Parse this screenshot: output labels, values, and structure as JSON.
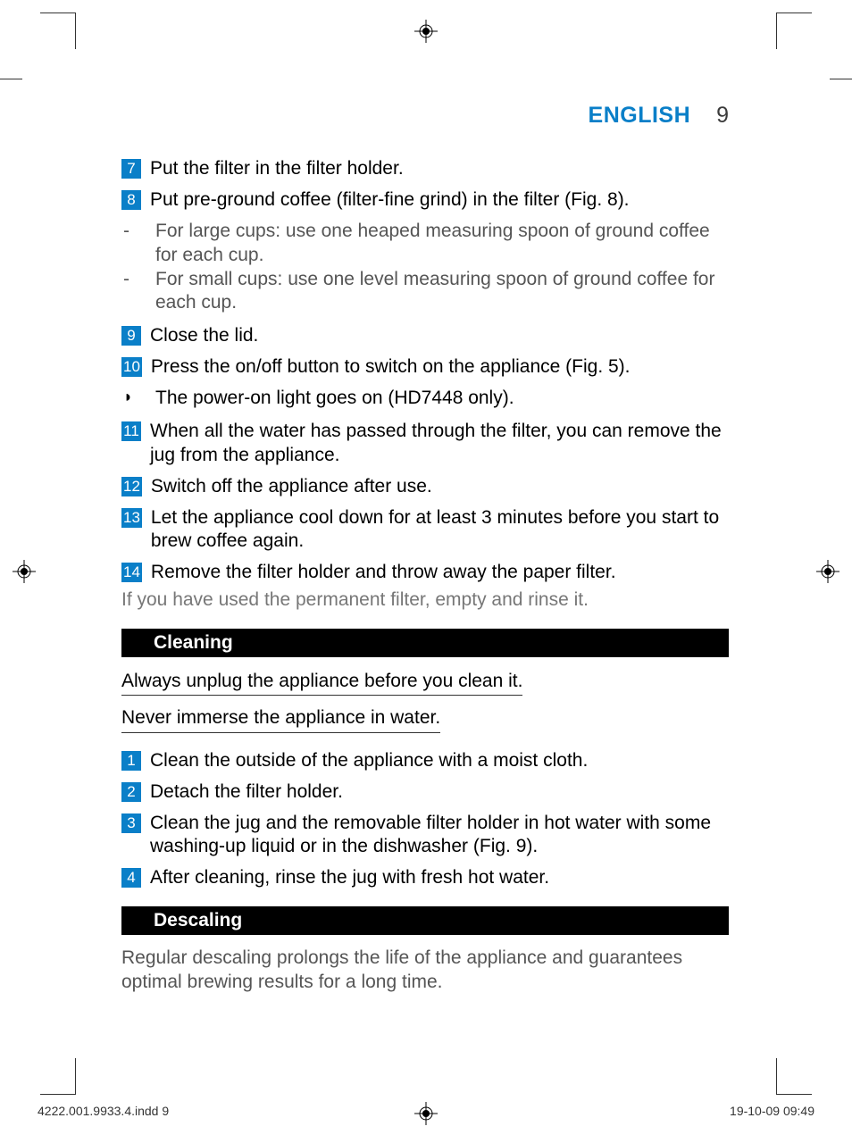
{
  "header": {
    "language": "ENGLISH",
    "page_number": "9"
  },
  "steps_a": [
    {
      "num": "7",
      "text": "Put the filter in the filter holder."
    },
    {
      "num": "8",
      "text": "Put pre-ground coffee (filter-fine grind) in the filter (Fig. 8)."
    }
  ],
  "sub8": [
    "For large cups: use one heaped measuring spoon of ground coffee for each cup.",
    "For small cups: use one level measuring spoon of ground coffee for each cup."
  ],
  "steps_b": [
    {
      "num": "9",
      "text": "Close the lid."
    },
    {
      "num": "10",
      "text": "Press the on/off button to switch on the appliance (Fig. 5)."
    }
  ],
  "arrow_note": "The power-on light goes on (HD7448 only).",
  "steps_c": [
    {
      "num": "11",
      "text": "When all the water has passed through the filter, you can remove the jug from the appliance."
    },
    {
      "num": "12",
      "text": "Switch off the appliance after use."
    },
    {
      "num": "13",
      "text": "Let the appliance cool down for at least 3 minutes before you start to brew coffee again."
    },
    {
      "num": "14",
      "text": "Remove the filter holder and throw away the paper filter."
    }
  ],
  "note_after_14": "If you have used the permanent filter, empty and rinse it.",
  "cleaning": {
    "title": "Cleaning",
    "warn1": "Always unplug the appliance before you clean it.",
    "warn2": "Never immerse the appliance in water.",
    "steps": [
      {
        "num": "1",
        "text": "Clean the outside of the appliance with a moist cloth."
      },
      {
        "num": "2",
        "text": "Detach the filter holder."
      },
      {
        "num": "3",
        "text": "Clean the jug and the removable filter holder in hot water with some washing-up liquid or in the dishwasher (Fig. 9)."
      },
      {
        "num": "4",
        "text": "After cleaning, rinse the jug with fresh hot water."
      }
    ]
  },
  "descaling": {
    "title": "Descaling",
    "text": "Regular descaling prolongs the life of the appliance and guarantees optimal brewing results for a long time."
  },
  "footer": {
    "file": "4222.001.9933.4.indd   9",
    "date": "19-10-09   09:49"
  }
}
